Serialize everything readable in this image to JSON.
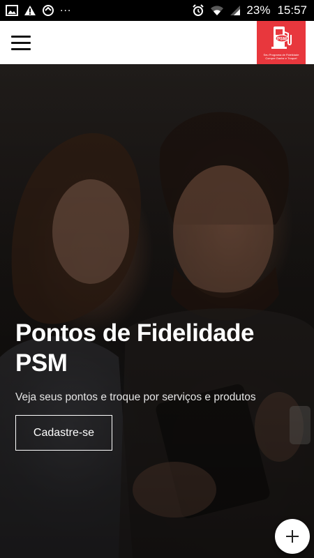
{
  "status_bar": {
    "left_icons": [
      "image-icon",
      "warning-icon",
      "sync-icon"
    ],
    "overflow": "...",
    "right_icons": [
      "alarm-icon",
      "wifi-icon",
      "signal-icon",
      "battery-icon"
    ],
    "battery": "23%",
    "time": "15:57"
  },
  "header": {
    "menu_icon": "hamburger-menu-icon",
    "logo": {
      "brand": "PSM",
      "tagline_line1": "Seu Programa de Fidelidade",
      "tagline_line2": "Compre Ganhe e Troque!",
      "color": "#e8373d"
    }
  },
  "hero": {
    "title": "Pontos de Fidelidade PSM",
    "subtitle": "Veja seus pontos e troque por serviços e produtos",
    "cta_label": "Cadastre-se"
  },
  "fab": {
    "icon": "plus-icon"
  }
}
